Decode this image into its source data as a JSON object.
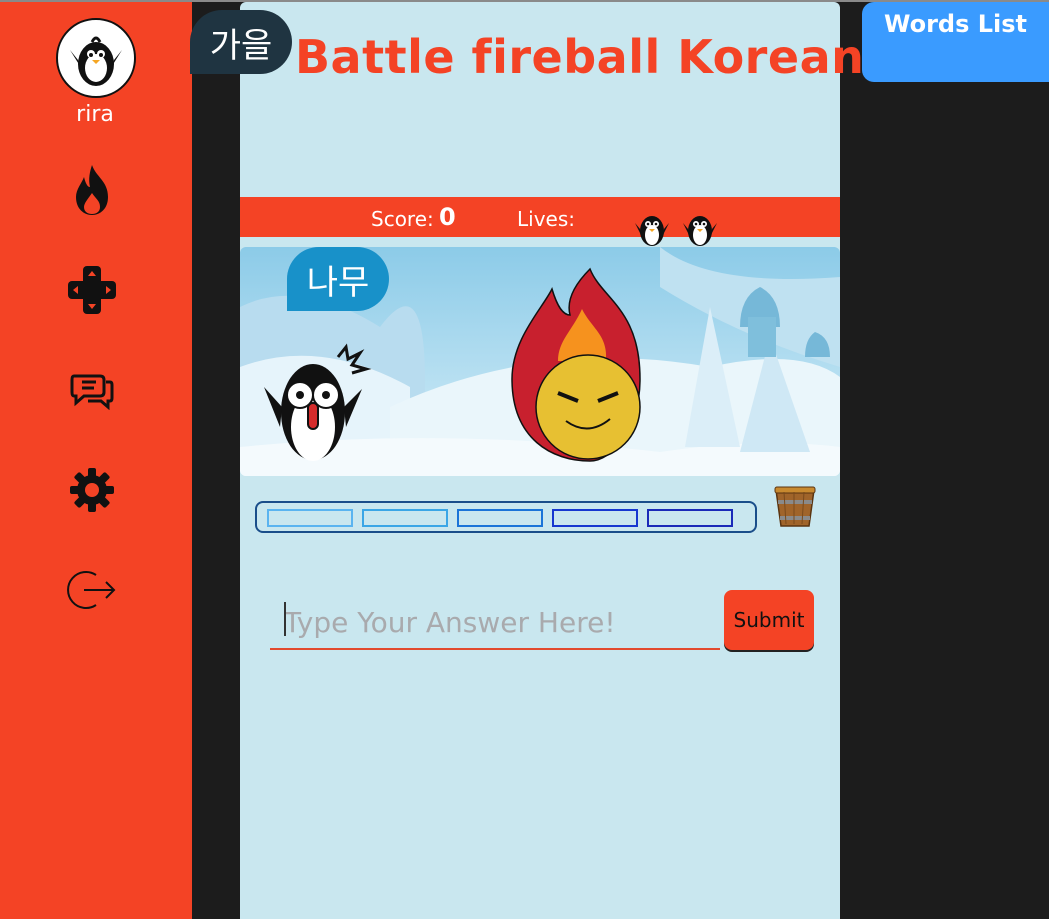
{
  "app": {
    "title": "Battle fireball Korean"
  },
  "sidebar": {
    "username": "rira",
    "items": [
      {
        "icon": "fire-icon"
      },
      {
        "icon": "gamepad-icon"
      },
      {
        "icon": "chat-icon"
      },
      {
        "icon": "gear-icon"
      },
      {
        "icon": "logout-icon"
      }
    ]
  },
  "header": {
    "category_word": "가을",
    "words_list_label": "Words List"
  },
  "scoreboard": {
    "score_label": "Score:",
    "score_value": "0",
    "lives_label": "Lives:",
    "lives_count": 2
  },
  "game": {
    "prompt_word": "나무",
    "progress_segments": [
      {
        "color": "#5ab4f0"
      },
      {
        "color": "#3aa6e6"
      },
      {
        "color": "#1a74d8"
      },
      {
        "color": "#1638d0"
      },
      {
        "color": "#1a2ab8"
      }
    ]
  },
  "answer": {
    "placeholder": "Type Your Answer Here!",
    "value": "",
    "submit_label": "Submit"
  },
  "colors": {
    "accent": "#f44325",
    "panel": "#c9e7ef",
    "words_button": "#3a9bff"
  }
}
